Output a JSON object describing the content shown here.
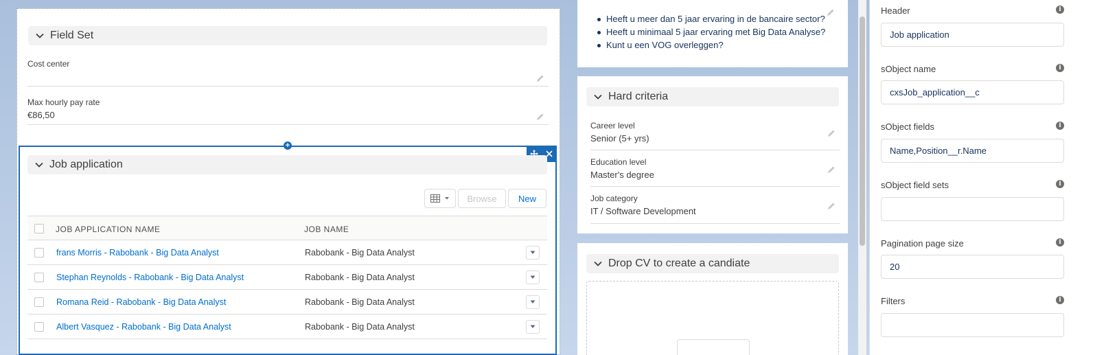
{
  "field_set": {
    "title": "Field Set",
    "fields": [
      {
        "label": "Cost center",
        "value": ""
      },
      {
        "label": "Max hourly pay rate",
        "value": "€86,50"
      }
    ]
  },
  "job_application": {
    "title": "Job application",
    "buttons": {
      "browse": "Browse",
      "new": "New"
    },
    "columns": [
      "JOB APPLICATION NAME",
      "JOB NAME"
    ],
    "rows": [
      {
        "name": "frans Morris - Rabobank - Big Data Analyst",
        "job": "Rabobank - Big Data Analyst"
      },
      {
        "name": "Stephan Reynolds - Rabobank - Big Data Analyst",
        "job": "Rabobank - Big Data Analyst"
      },
      {
        "name": "Romana Reid - Rabobank - Big Data Analyst",
        "job": "Rabobank - Big Data Analyst"
      },
      {
        "name": "Albert Vasquez - Rabobank - Big Data Analyst",
        "job": "Rabobank - Big Data Analyst"
      }
    ]
  },
  "questions": [
    "Heeft u meer dan 5 jaar ervaring in de bancaire sector?",
    "Heeft u minimaal 5 jaar ervaring met Big Data Analyse?",
    "Kunt u een VOG overleggen?"
  ],
  "hard_criteria": {
    "title": "Hard criteria",
    "fields": [
      {
        "label": "Career level",
        "value": "Senior (5+ yrs)"
      },
      {
        "label": "Education level",
        "value": "Master's degree"
      },
      {
        "label": "Job category",
        "value": "IT / Software Development"
      }
    ]
  },
  "drop_cv": {
    "title": "Drop CV to create a candiate"
  },
  "properties": [
    {
      "label": "Header",
      "value": ""
    },
    {
      "label": "sObject name",
      "value": ""
    },
    {
      "label": "sObject fields",
      "value": ""
    },
    {
      "label": "sObject field sets",
      "value": ""
    },
    {
      "label": "Pagination page size",
      "value": ""
    },
    {
      "label": "Filters",
      "value": ""
    }
  ],
  "property_values": [
    "Job application",
    "cxsJob_application__c",
    "Name,Position__r.Name",
    "",
    "20",
    ""
  ],
  "colors": {
    "brand_blue": "#1b6bb5",
    "link": "#006dcc",
    "header_bg": "#f3f2f2"
  }
}
